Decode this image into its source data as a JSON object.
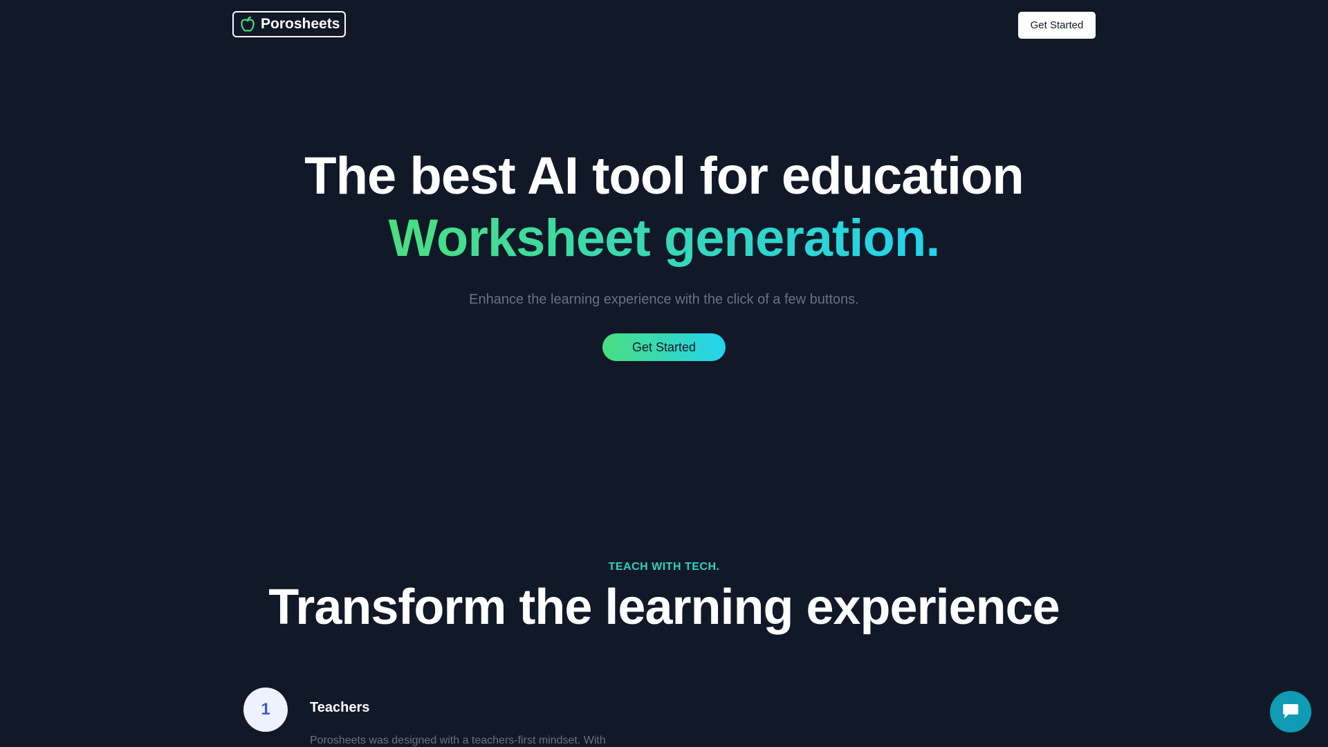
{
  "header": {
    "logo_text": "Porosheets",
    "cta_label": "Get Started"
  },
  "hero": {
    "title": "The best AI tool for education",
    "accent": "Worksheet generation.",
    "subtitle": "Enhance the learning experience with the click of a few buttons.",
    "cta_label": "Get Started"
  },
  "section": {
    "eyebrow": "TEACH WITH TECH.",
    "title": "Transform the learning experience",
    "steps": [
      {
        "number": "1",
        "title": "Teachers",
        "text": "Porosheets was designed with a teachers-first mindset. With"
      }
    ]
  },
  "icons": {
    "logo": "apple-icon",
    "chat": "chat-icon"
  },
  "colors": {
    "background": "#111827",
    "accent_start": "#4ade80",
    "accent_end": "#22d3ee",
    "eyebrow": "#2dd4bf",
    "chat": "#0e9bb3"
  }
}
